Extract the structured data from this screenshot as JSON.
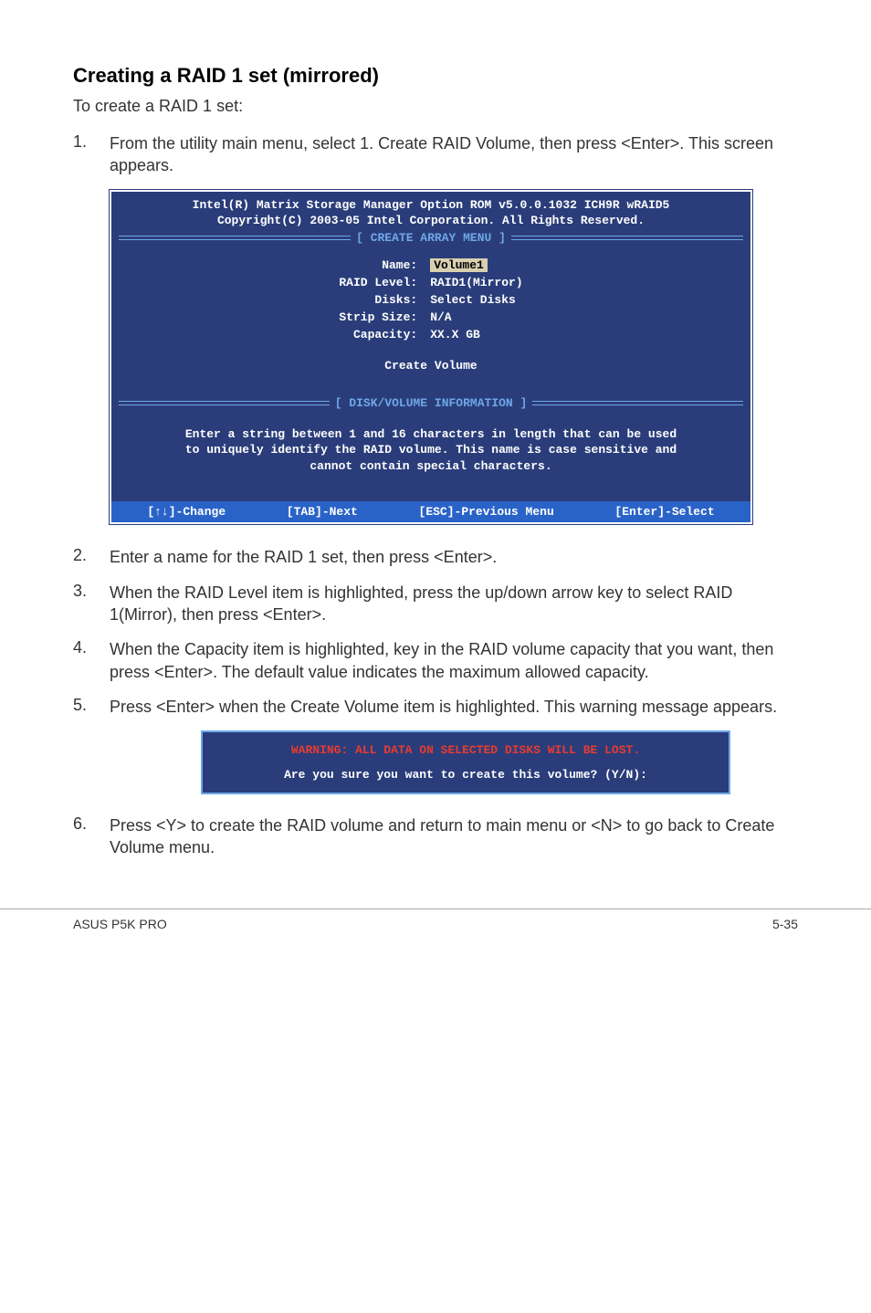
{
  "heading": "Creating a RAID 1 set (mirrored)",
  "intro": "To create a RAID 1 set:",
  "steps": {
    "s1": "From the utility main menu, select 1. Create RAID Volume, then press <Enter>. This screen appears.",
    "s2": "Enter a name for the RAID 1 set, then press <Enter>.",
    "s3": "When the RAID Level item is highlighted, press the up/down arrow key to select RAID 1(Mirror), then press <Enter>.",
    "s4": "When the Capacity item is highlighted, key in the RAID volume capacity that you want, then press <Enter>. The default value indicates the maximum allowed capacity.",
    "s5": "Press <Enter> when the Create Volume item is highlighted. This warning message appears.",
    "s6": "Press <Y> to create the RAID volume and return to main menu or <N> to go back to Create Volume menu."
  },
  "bios": {
    "title1": "Intel(R) Matrix Storage Manager Option ROM v5.0.0.1032 ICH9R wRAID5",
    "title2": "Copyright(C) 2003-05 Intel Corporation. All Rights Reserved.",
    "section_create": "[ CREATE ARRAY MENU ]",
    "fields": {
      "name_label": "Name:",
      "name_value": "Volume1",
      "raid_level_label": "RAID Level:",
      "raid_level_value": "RAID1(Mirror)",
      "disks_label": "Disks:",
      "disks_value": "Select Disks",
      "strip_label": "Strip Size:",
      "strip_value": "N/A",
      "capacity_label": "Capacity:",
      "capacity_value": "XX.X  GB"
    },
    "create_volume": "Create Volume",
    "section_info": "[ DISK/VOLUME INFORMATION ]",
    "help1": "Enter a string between 1 and 16 characters in length that can be used",
    "help2": "to uniquely identify the RAID volume. This name is case sensitive and",
    "help3": "cannot contain special characters.",
    "foot_change": "[↑↓]-Change",
    "foot_tab": "[TAB]-Next",
    "foot_esc": "[ESC]-Previous Menu",
    "foot_enter": "[Enter]-Select"
  },
  "warning": {
    "red": "WARNING: ALL DATA ON SELECTED DISKS WILL BE LOST.",
    "white": "Are you sure you want to create this volume? (Y/N):"
  },
  "footer": {
    "left": "ASUS P5K PRO",
    "right": "5-35"
  }
}
